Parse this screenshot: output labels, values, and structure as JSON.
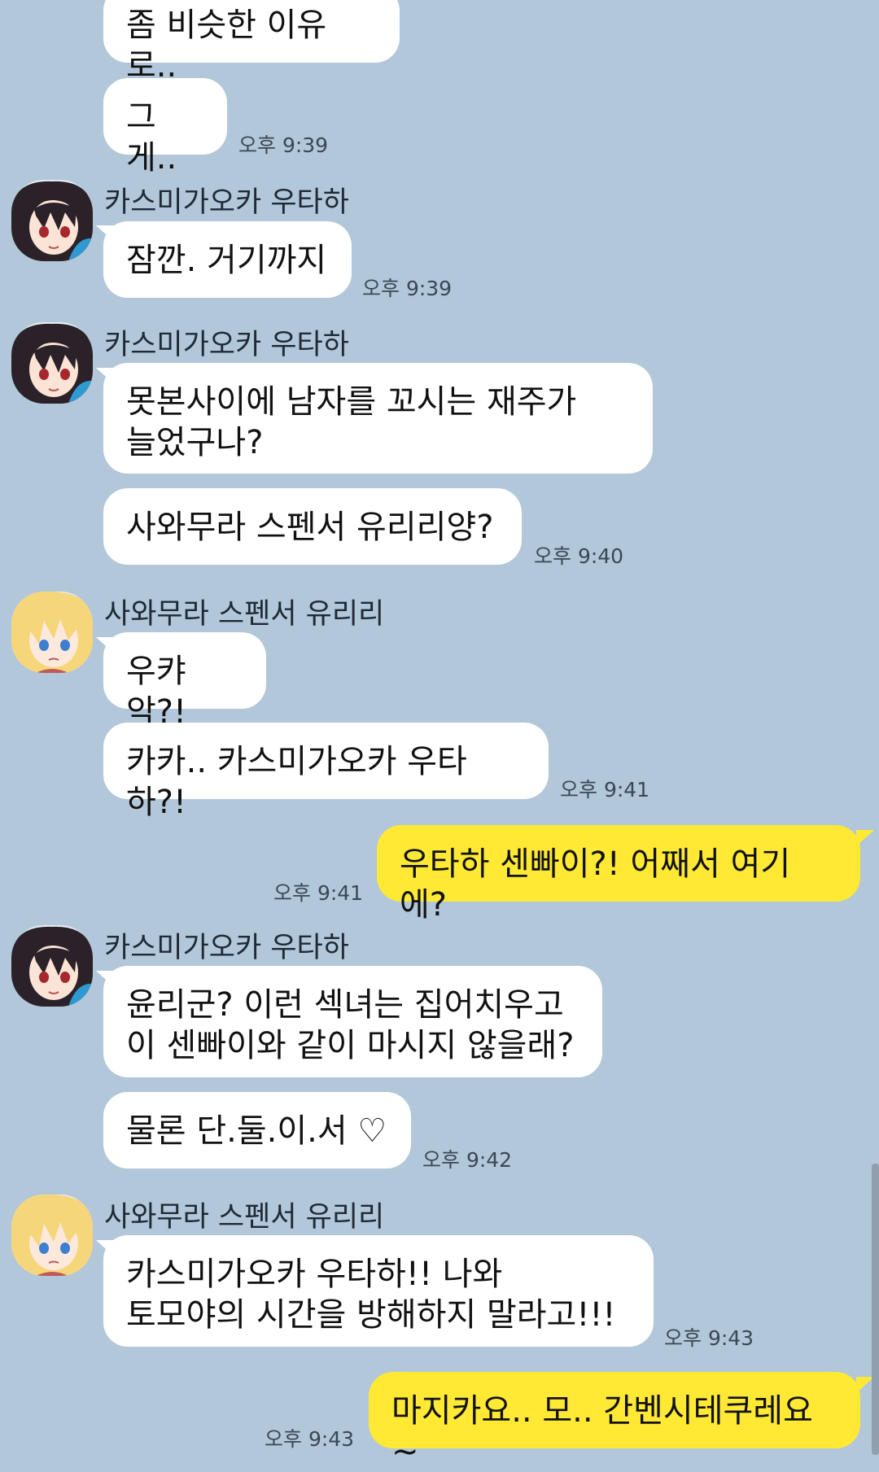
{
  "messages": [
    {
      "text": "좀 비슷한 이유로.."
    },
    {
      "text": "그게..",
      "time": "오후 9:39"
    },
    {
      "sender": "카스미가오카 우타하",
      "text": "잠깐. 거기까지",
      "time": "오후 9:39"
    },
    {
      "sender": "카스미가오카 우타하",
      "text": "못본사이에 남자를 꼬시는 재주가\n늘었구나?"
    },
    {
      "text": "사와무라 스펜서 유리리양?",
      "time": "오후 9:40"
    },
    {
      "sender": "사와무라 스펜서 유리리",
      "text": "우캬악?!"
    },
    {
      "text": "카카.. 카스미가오카 우타하?!",
      "time": "오후 9:41"
    },
    {
      "text": "우타하 센빠이?! 어째서 여기에?",
      "time": "오후 9:41"
    },
    {
      "sender": "카스미가오카 우타하",
      "text": "윤리군? 이런 섹녀는 집어치우고\n이 센빠이와 같이 마시지 않을래?"
    },
    {
      "text": "물론 단.둘.이.서 ♡",
      "time": "오후 9:42"
    },
    {
      "sender": "사와무라 스펜서 유리리",
      "text": "카스미가오카 우타하!! 나와\n토모야의 시간을 방해하지 말라고!!!",
      "time": "오후 9:43"
    },
    {
      "text": "마지카요.. 모.. 간벤시테쿠레요~",
      "time": "오후 9:43"
    }
  ],
  "colors": {
    "background": "#b2c7da",
    "incoming_bubble": "#ffffff",
    "outgoing_bubble": "#ffe934"
  }
}
